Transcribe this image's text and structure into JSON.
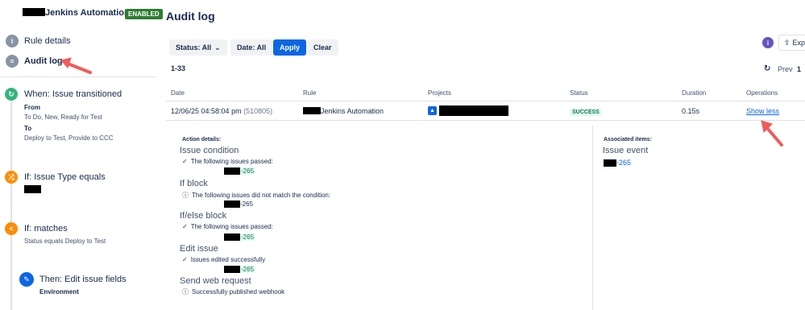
{
  "sidebar": {
    "rule_name": "Jenkins Automation",
    "status_badge": "ENABLED",
    "nav": {
      "rule_details": "Rule details",
      "audit_log": "Audit log"
    },
    "components": {
      "when_title": "When: Issue transitioned",
      "when_from_label": "From",
      "when_from_value": "To Do, New, Ready for Test",
      "when_to_label": "To",
      "when_to_value": "Deploy to Test, Provide to CCC",
      "if1_title": "If: Issue Type equals",
      "if2_title": "If: matches",
      "if2_sub": "Status equals Deploy to Test",
      "then_title": "Then: Edit issue fields",
      "then_sub": "Environment"
    }
  },
  "main": {
    "title": "Audit log",
    "filters": {
      "status": "Status: All",
      "date": "Date: All",
      "apply": "Apply",
      "clear": "Clear"
    },
    "export_label": "Exp",
    "range": "1-33",
    "pagination": {
      "prev": "Prev",
      "page": "1"
    },
    "table": {
      "headers": {
        "date": "Date",
        "rule": "Rule",
        "projects": "Projects",
        "status": "Status",
        "duration": "Duration",
        "operations": "Operations"
      },
      "row": {
        "date": "12/06/25 04:58:04 pm",
        "id": "(510805)",
        "rule": "Jenkins Automation",
        "status": "SUCCESS",
        "duration": "0.15s",
        "operation": "Show less"
      }
    },
    "details": {
      "action_details_label": "Action details:",
      "associated_label": "Associated items:",
      "issue_event": "Issue event",
      "assoc_key": "-265",
      "issue_key_suffix": "-265",
      "sections": {
        "issue_condition": "Issue condition",
        "issue_condition_line": "The following issues passed:",
        "if_block": "If block",
        "if_block_line": "The following issues did not match the condition:",
        "ifelse_block": "If/else block",
        "ifelse_line": "The following issues passed:",
        "edit_issue": "Edit issue",
        "edit_issue_line": "Issues edited successfully",
        "web_request": "Send web request",
        "web_request_line": "Successfully published webhook"
      }
    }
  },
  "colors": {
    "primary": "#0c66e4",
    "success_bg": "#dcfff1",
    "enabled_badge": "#2e7d32",
    "annotation_arrow": "#f15b5b"
  }
}
